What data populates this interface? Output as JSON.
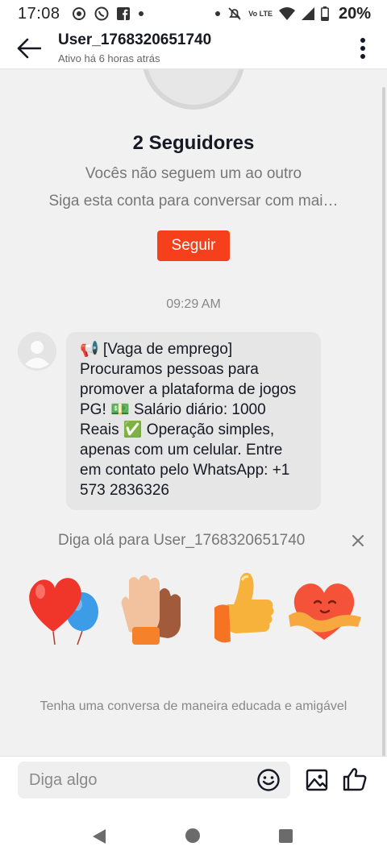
{
  "status_bar": {
    "time": "17:08",
    "battery": "20%",
    "icons_left": [
      "location-icon",
      "whatsapp-icon",
      "facebook-icon",
      "dot-icon"
    ],
    "icons_right": [
      "dot-icon",
      "mute-icon",
      "volte-icon",
      "wifi-icon",
      "signal-icon",
      "battery-icon"
    ],
    "volte_label": "Vo LTE"
  },
  "header": {
    "title": "User_1768320651740",
    "subtitle": "Ativo há 6 horas atrás"
  },
  "profile": {
    "followers": "2 Seguidores",
    "relationship": "Vocês não seguem um ao outro",
    "hint": "Siga esta conta para conversar com mai…",
    "follow_label": "Seguir"
  },
  "chat": {
    "timestamp": "09:29 AM",
    "message": "📢 [Vaga de emprego] Procuramos pessoas para promover a plataforma de jogos PG! 💵 Salário diário: 1000 Reais ✅ Operação simples, apenas com um celular. Entre em contato pelo WhatsApp: +1 573 2836326"
  },
  "greeting": {
    "text": "Diga olá para User_1768320651740",
    "stickers": [
      "heart-balloons-icon",
      "clapping-hands-icon",
      "thumbs-up-icon",
      "hugging-heart-icon"
    ]
  },
  "notice": "Tenha uma conversa de maneira educada e amigável",
  "input": {
    "placeholder": "Diga algo"
  },
  "colors": {
    "accent": "#f5401b",
    "bubble": "#e6e6e6",
    "background": "#f1f1f1"
  }
}
